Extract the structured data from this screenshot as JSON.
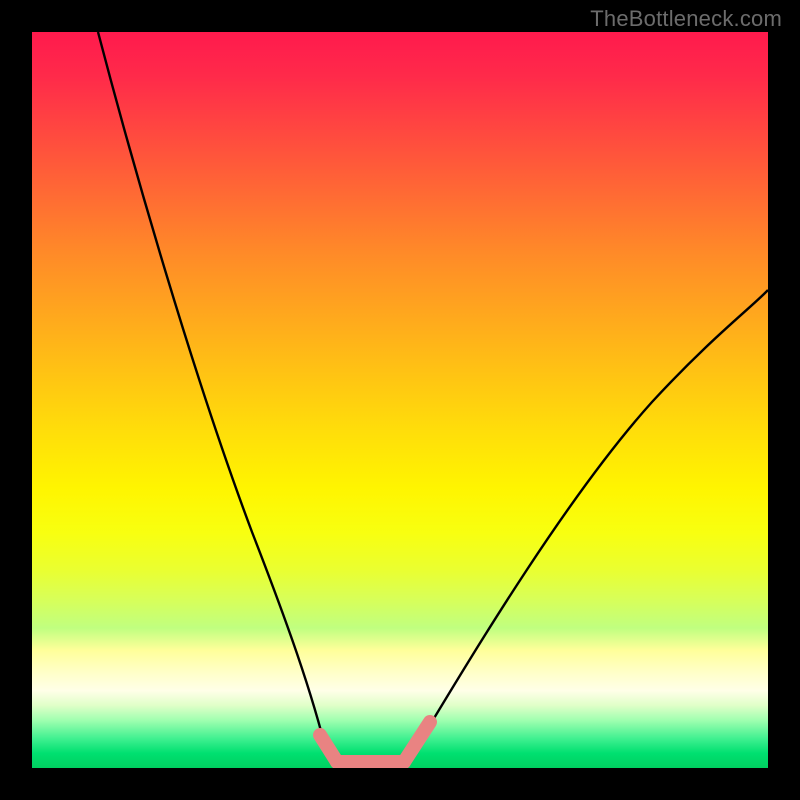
{
  "attribution": "TheBottleneck.com",
  "chart_data": {
    "type": "line",
    "title": "",
    "xlabel": "",
    "ylabel": "",
    "xlim": [
      0,
      1
    ],
    "ylim": [
      0,
      1
    ],
    "series": [
      {
        "name": "left-curve",
        "x": [
          0.09,
          0.12,
          0.16,
          0.2,
          0.24,
          0.28,
          0.32,
          0.35,
          0.38,
          0.402
        ],
        "y": [
          1.0,
          0.87,
          0.72,
          0.58,
          0.44,
          0.31,
          0.19,
          0.11,
          0.05,
          0.01
        ]
      },
      {
        "name": "bottom-segment",
        "x": [
          0.402,
          0.43,
          0.46,
          0.49,
          0.513
        ],
        "y": [
          0.01,
          0.002,
          0.0,
          0.002,
          0.01
        ]
      },
      {
        "name": "right-curve",
        "x": [
          0.513,
          0.56,
          0.62,
          0.68,
          0.74,
          0.8,
          0.86,
          0.92,
          0.98,
          1.0
        ],
        "y": [
          0.01,
          0.08,
          0.18,
          0.28,
          0.37,
          0.45,
          0.52,
          0.58,
          0.63,
          0.65
        ]
      }
    ],
    "highlight": {
      "name": "pink-highlight",
      "color": "#e98382",
      "segments": [
        {
          "x": [
            0.392,
            0.414
          ],
          "y": [
            0.045,
            0.008
          ]
        },
        {
          "x": [
            0.414,
            0.505
          ],
          "y": [
            0.008,
            0.008
          ]
        },
        {
          "x": [
            0.505,
            0.54
          ],
          "y": [
            0.008,
            0.06
          ]
        }
      ]
    },
    "background_gradient": {
      "stops": [
        {
          "pos": 0.0,
          "color": "#ff1a4d"
        },
        {
          "pos": 0.3,
          "color": "#ff8a28"
        },
        {
          "pos": 0.62,
          "color": "#fff500"
        },
        {
          "pos": 0.87,
          "color": "#ffffc8"
        },
        {
          "pos": 1.0,
          "color": "#00d060"
        }
      ]
    }
  }
}
